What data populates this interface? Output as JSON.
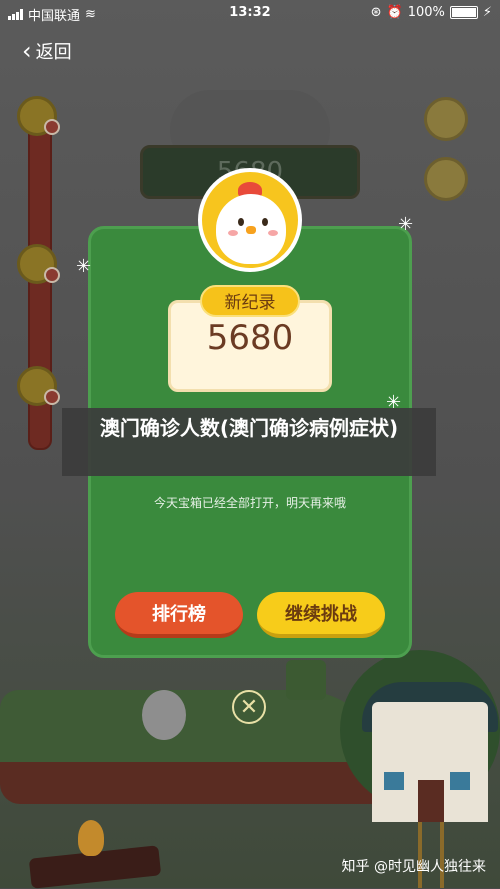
{
  "status_bar": {
    "carrier": "中国联通",
    "time": "13:32",
    "battery_percent": "100%"
  },
  "nav": {
    "back_label": "返回"
  },
  "game": {
    "background_score": "5680"
  },
  "dialog": {
    "badge_label": "新纪录",
    "score": "5680",
    "title": "澳门确诊人数(澳门确诊病例症状)",
    "subtitle": "今天宝箱已经全部打开，明天再来哦",
    "rank_button": "排行榜",
    "continue_button": "继续挑战",
    "close_symbol": "✕"
  },
  "watermark": "知乎 @时见幽人独往来",
  "colors": {
    "dialog_green": "#3a8a3d",
    "rank_red": "#e4542b",
    "continue_yellow": "#f7cc1a",
    "record_text": "#6b3b23"
  },
  "icons": {
    "back": "chevron-left-icon",
    "close": "close-circle-icon",
    "trophy": "trophy-icon",
    "sound": "speaker-icon",
    "avatar": "chick-avatar"
  }
}
